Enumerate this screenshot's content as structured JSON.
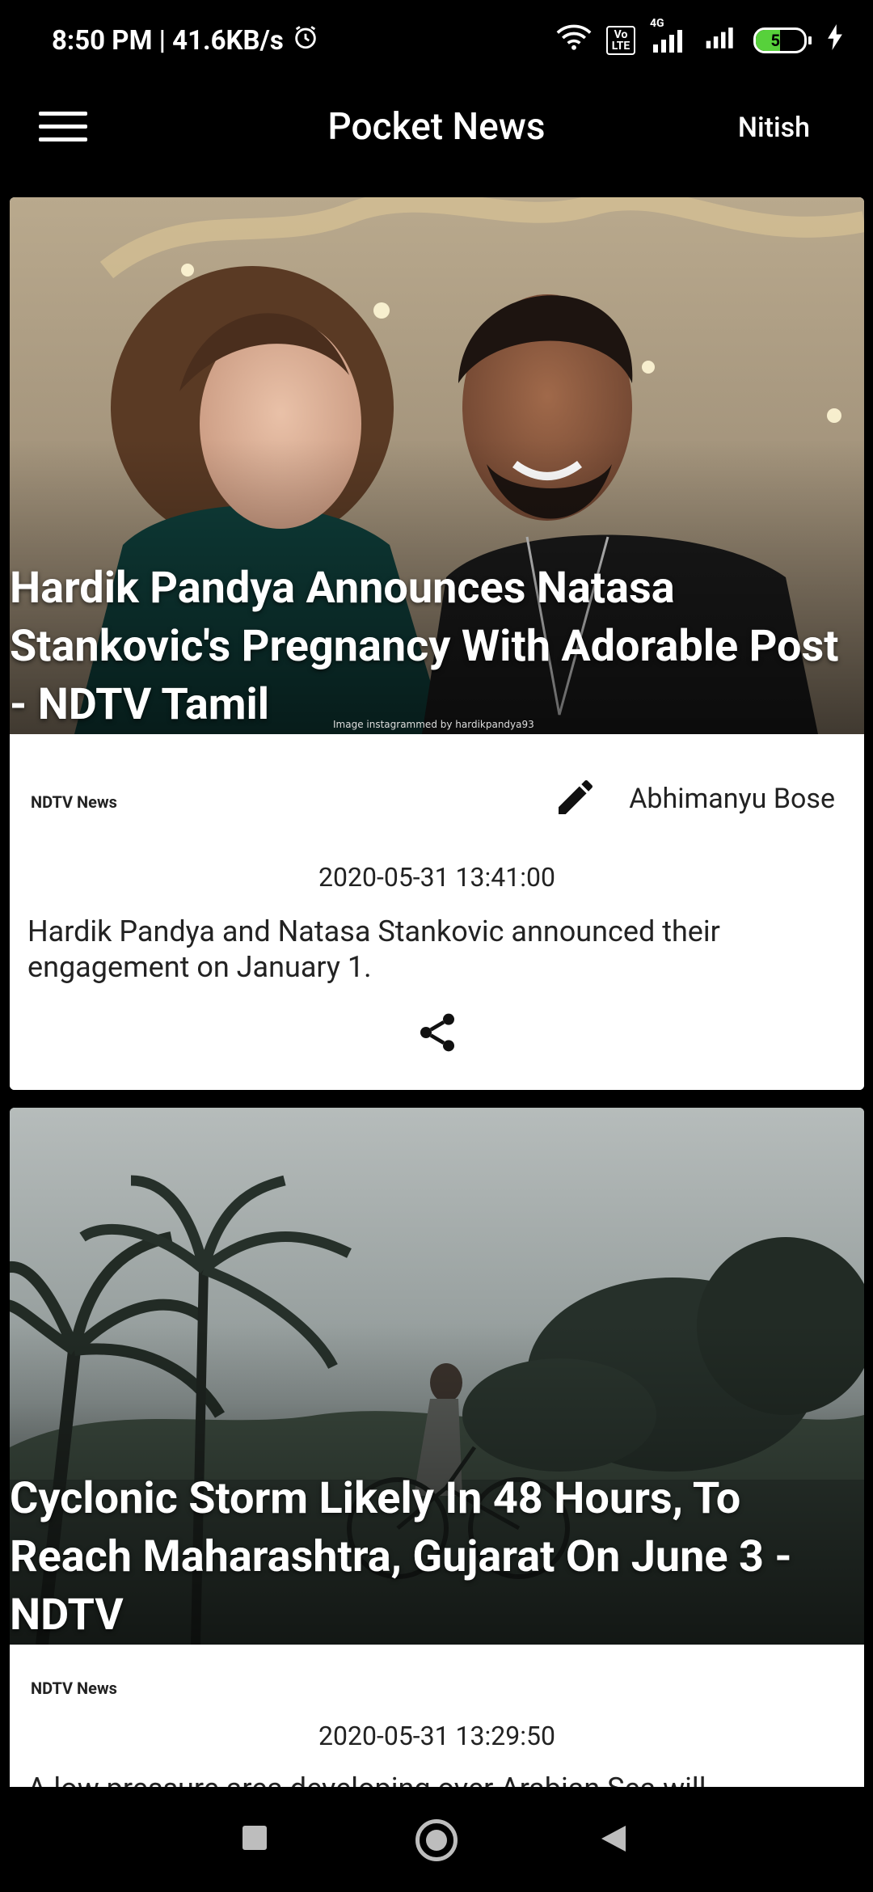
{
  "status_bar": {
    "time_speed": "8:50 PM | 41.6KB/s",
    "network": "4G",
    "volte": "Vo LTE",
    "battery": "50"
  },
  "app_bar": {
    "title": "Pocket News",
    "user": "Nitish"
  },
  "articles": [
    {
      "title": "Hardik Pandya Announces Natasa Stankovic's Pregnancy With Adorable Post - NDTV Tamil",
      "source": "NDTV News",
      "author": "Abhimanyu Bose",
      "date": "2020-05-31 13:41:00",
      "description": "Hardik Pandya and Natasa Stankovic announced their engagement on January 1.",
      "image_caption": "Image instagrammed by hardikpandya93"
    },
    {
      "title": "Cyclonic Storm Likely In 48 Hours, To Reach Maharashtra, Gujarat On June 3 - NDTV",
      "source": "NDTV News",
      "date": "2020-05-31 13:29:50",
      "description": "A low pressure area developing over Arabian Sea will"
    }
  ]
}
